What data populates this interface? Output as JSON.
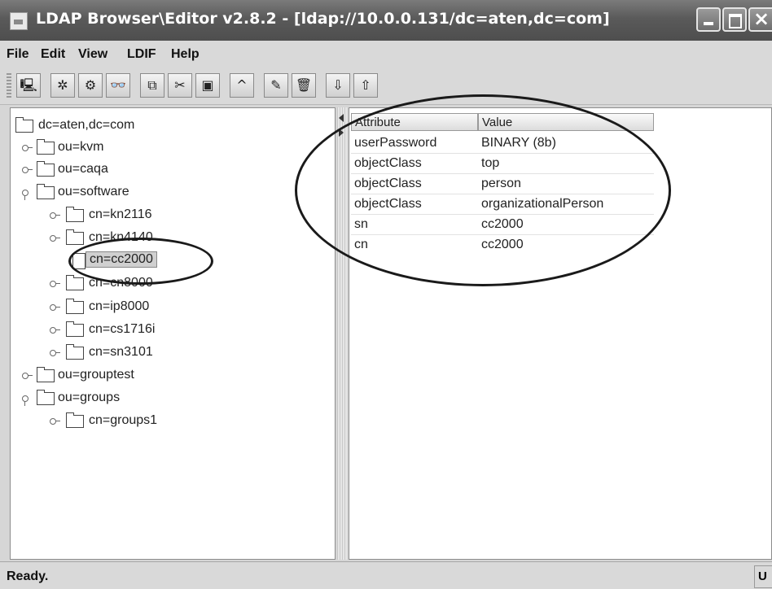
{
  "window": {
    "title": "LDAP Browser\\Editor v2.8.2 - [ldap://10.0.0.131/dc=aten,dc=com]"
  },
  "menu": {
    "items": [
      "File",
      "Edit",
      "View",
      "LDIF",
      "Help"
    ]
  },
  "toolbar": {
    "buttons": [
      {
        "name": "connect",
        "glyph": "🖳"
      },
      {
        "name": "refresh",
        "glyph": "✲"
      },
      {
        "name": "reconnect",
        "glyph": "⚙"
      },
      {
        "name": "search",
        "glyph": "👓"
      },
      {
        "name": "copy",
        "glyph": "⧉"
      },
      {
        "name": "cut",
        "glyph": "✂"
      },
      {
        "name": "paste",
        "glyph": "▣"
      },
      {
        "name": "up",
        "glyph": "^"
      },
      {
        "name": "edit",
        "glyph": "✎"
      },
      {
        "name": "delete",
        "glyph": "🗑"
      },
      {
        "name": "import",
        "glyph": "⇩"
      },
      {
        "name": "export",
        "glyph": "⇧"
      }
    ]
  },
  "tree": {
    "root": "dc=aten,dc=com",
    "nodes": [
      {
        "label": "ou=kvm",
        "level": 1,
        "expanded": false,
        "leaf": false
      },
      {
        "label": "ou=caqa",
        "level": 1,
        "expanded": false,
        "leaf": false
      },
      {
        "label": "ou=software",
        "level": 1,
        "expanded": true,
        "leaf": false
      },
      {
        "label": "cn=kn2116",
        "level": 2,
        "expanded": false,
        "leaf": false
      },
      {
        "label": "cn=kn4140",
        "level": 2,
        "expanded": false,
        "leaf": false
      },
      {
        "label": "cn=cc2000",
        "level": 2,
        "expanded": false,
        "leaf": true,
        "selected": true
      },
      {
        "label": "cn=cn8000",
        "level": 2,
        "expanded": false,
        "leaf": false
      },
      {
        "label": "cn=ip8000",
        "level": 2,
        "expanded": false,
        "leaf": false
      },
      {
        "label": "cn=cs1716i",
        "level": 2,
        "expanded": false,
        "leaf": false
      },
      {
        "label": "cn=sn3101",
        "level": 2,
        "expanded": false,
        "leaf": false
      },
      {
        "label": "ou=grouptest",
        "level": 1,
        "expanded": false,
        "leaf": false
      },
      {
        "label": "ou=groups",
        "level": 1,
        "expanded": true,
        "leaf": false
      },
      {
        "label": "cn=groups1",
        "level": 2,
        "expanded": false,
        "leaf": false
      }
    ]
  },
  "attributes": {
    "columns": [
      "Attribute",
      "Value"
    ],
    "rows": [
      {
        "attribute": "userPassword",
        "value": "BINARY (8b)"
      },
      {
        "attribute": "objectClass",
        "value": "top"
      },
      {
        "attribute": "objectClass",
        "value": "person"
      },
      {
        "attribute": "objectClass",
        "value": "organizationalPerson"
      },
      {
        "attribute": "sn",
        "value": "cc2000"
      },
      {
        "attribute": "cn",
        "value": "cc2000"
      }
    ]
  },
  "status": {
    "text": "Ready.",
    "right": "U"
  }
}
